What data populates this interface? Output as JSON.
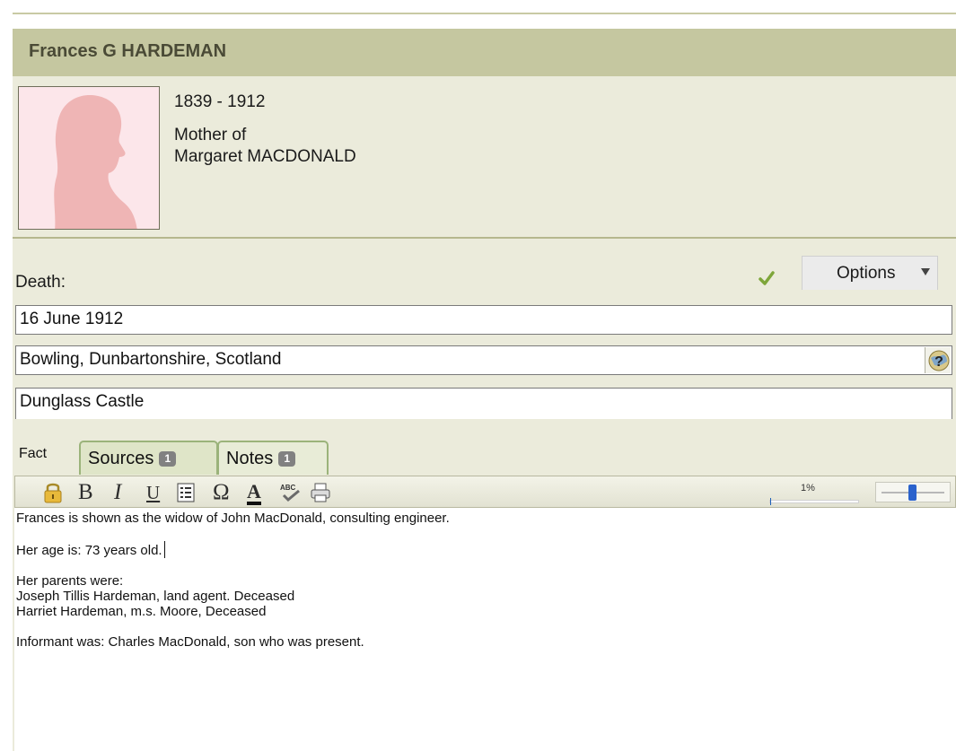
{
  "person": {
    "name": "Frances G HARDEMAN",
    "dates": "1839 - 1912",
    "relation_line1": "Mother of",
    "relation_line2": "Margaret MACDONALD"
  },
  "fact": {
    "label": "Death:",
    "options_label": "Options",
    "date": "16 June 1912",
    "place": "Bowling, Dunbartonshire, Scotland",
    "description": "Dunglass Castle"
  },
  "tabs": {
    "fact_label": "Fact",
    "sources_label": "Sources",
    "sources_count": "1",
    "notes_label": "Notes",
    "notes_count": "1"
  },
  "toolbar": {
    "bold": "B",
    "italic": "I",
    "underline": "U",
    "special_char": "Ω",
    "font_color": "A",
    "zoom_text": "1%",
    "zoom_value": 0.01
  },
  "notes": {
    "line1": "Frances is shown as the widow of John MacDonald, consulting engineer.",
    "line2": "Her age is: 73 years old.",
    "line3": "Her parents were:",
    "line4": "Joseph Tillis Hardeman, land agent. Deceased",
    "line5": "Harriet Hardeman, m.s. Moore, Deceased",
    "line6": "Informant was: Charles MacDonald, son who was present."
  },
  "icons": {
    "check": "check-icon",
    "lock": "lock-icon",
    "list": "bullet-list-icon",
    "spellcheck": "spellcheck-icon",
    "print": "printer-icon",
    "place_lookup": "place-lookup-icon"
  },
  "colors": {
    "name_bar": "#c5c7a0",
    "panel_bg": "#ebebdb",
    "photo_bg": "#fce6ea",
    "silhouette": "#efb5b5",
    "check": "#7ea63a",
    "tab_border": "#9bb37a"
  }
}
